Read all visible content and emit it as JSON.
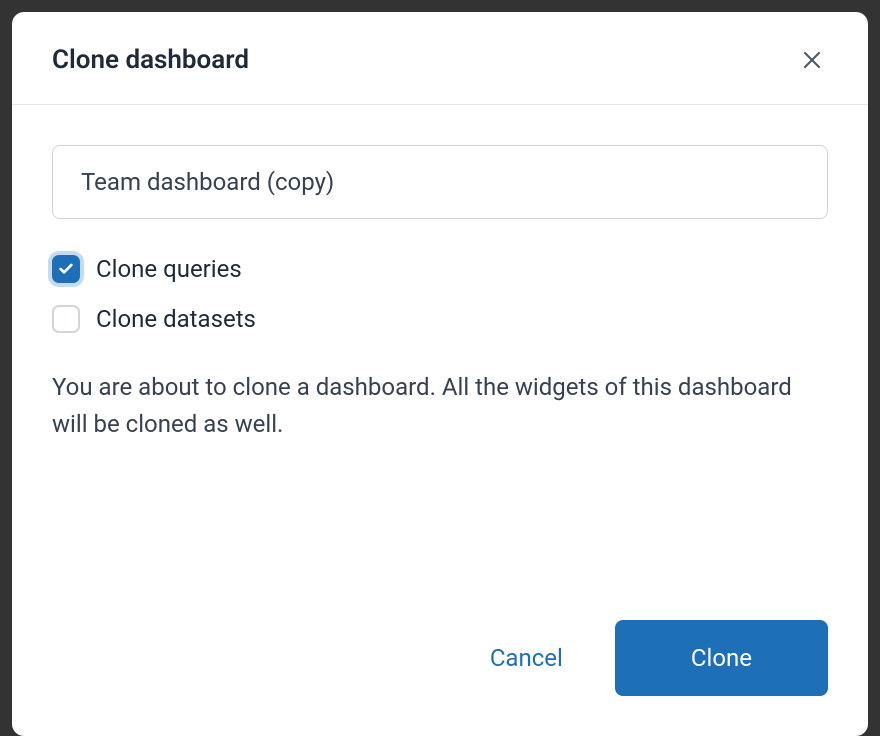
{
  "modal": {
    "title": "Clone dashboard",
    "name_input_value": "Team dashboard (copy)",
    "checkboxes": {
      "clone_queries": {
        "label": "Clone queries",
        "checked": true
      },
      "clone_datasets": {
        "label": "Clone datasets",
        "checked": false
      }
    },
    "info_text": "You are about to clone a dashboard. All the widgets of this dashboard will be cloned as well.",
    "footer": {
      "cancel_label": "Cancel",
      "clone_label": "Clone"
    }
  }
}
